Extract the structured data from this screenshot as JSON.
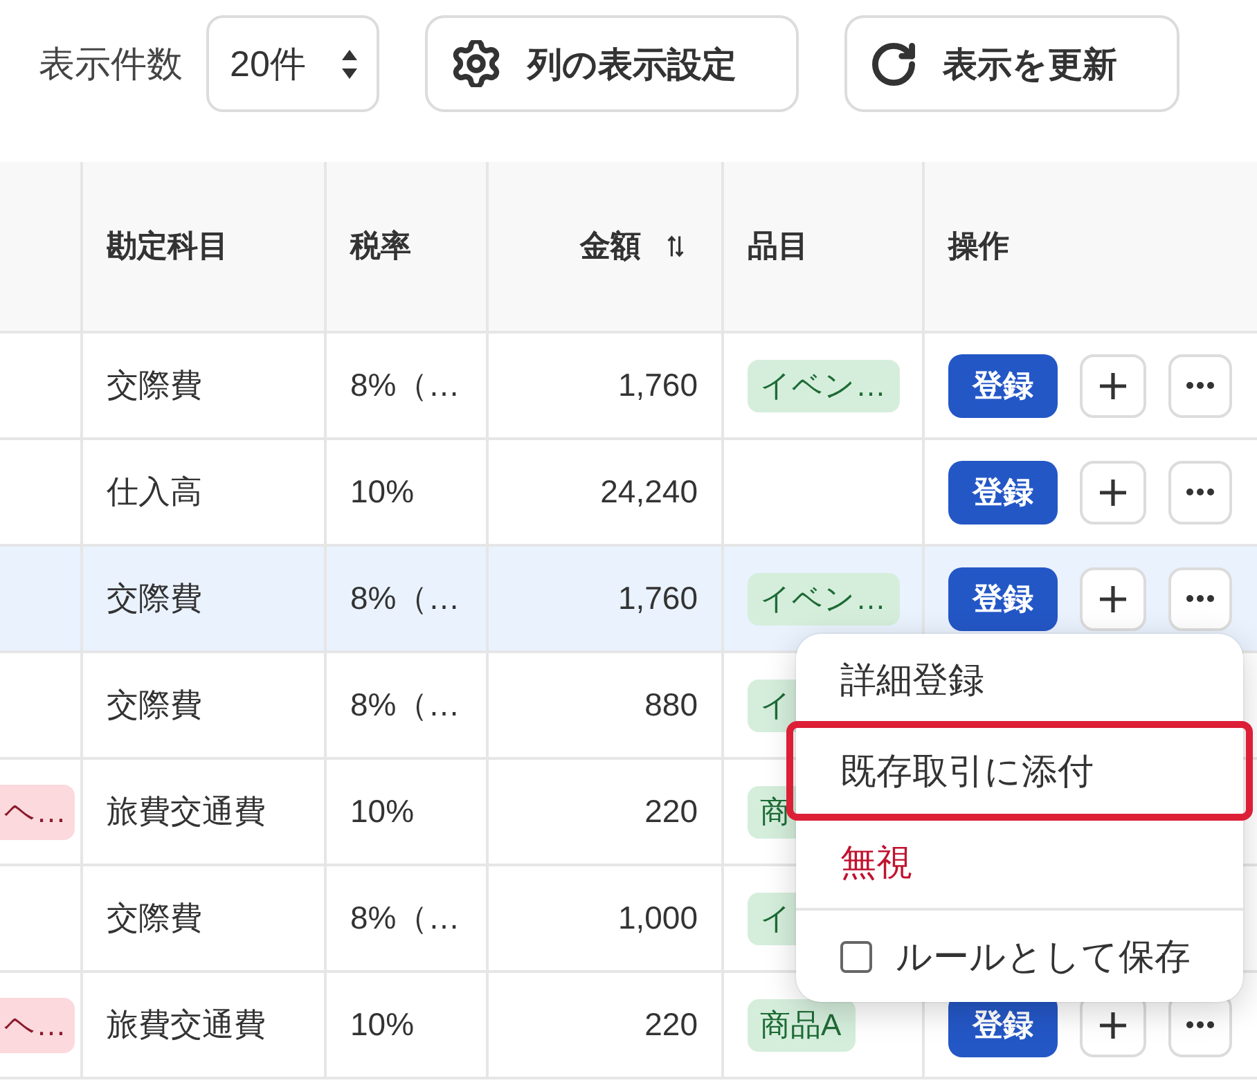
{
  "toolbar": {
    "page_size_label": "表示件数",
    "page_size": {
      "value": "20件"
    },
    "buttons": [
      {
        "kind": "columns",
        "label": "列の表示設定"
      },
      {
        "kind": "refresh",
        "label": "表示を更新"
      }
    ]
  },
  "table": {
    "columns": [
      {
        "label": "勘定科目",
        "sortable": false
      },
      {
        "label": "税率",
        "sortable": false
      },
      {
        "label": "金額",
        "sortable": true
      },
      {
        "label": "品目",
        "sortable": false
      },
      {
        "label": "操作",
        "sortable": false
      }
    ],
    "rows": [
      {
        "selected": false,
        "account": "交際費",
        "tax_rate": "8%（…",
        "amount": "1,760",
        "item_tag": "イベン…",
        "actions": {
          "register": "登録"
        }
      },
      {
        "selected": false,
        "account": "仕入高",
        "tax_rate": "10%",
        "amount": "24,240",
        "actions": {
          "register": "登録"
        }
      },
      {
        "selected": true,
        "account": "交際費",
        "tax_rate": "8%（…",
        "amount": "1,760",
        "item_tag": "イベン…",
        "actions": {
          "register": "登録"
        }
      },
      {
        "selected": false,
        "account": "交際費",
        "tax_rate": "8%（…",
        "amount": "880",
        "item_tag": "イ"
      },
      {
        "selected": false,
        "column_1_tag": "ヘ…",
        "account": "旅費交通費",
        "tax_rate": "10%",
        "amount": "220",
        "item_tag": "商"
      },
      {
        "selected": false,
        "account": "交際費",
        "tax_rate": "8%（…",
        "amount": "1,000",
        "item_tag": "イ"
      },
      {
        "selected": false,
        "column_1_tag": "ヘ…",
        "account": "旅費交通費",
        "tax_rate": "10%",
        "amount": "220",
        "item_tag": "商品A",
        "actions": {
          "register": "登録"
        }
      }
    ]
  },
  "menu": {
    "items": [
      {
        "kind": "action",
        "label": "詳細登録",
        "highlighted": false
      },
      {
        "kind": "action",
        "label": "既存取引に添付",
        "highlighted": true
      },
      {
        "kind": "danger",
        "label": "無視",
        "highlighted": false
      },
      {
        "kind": "checkbox",
        "label": "ルールとして保存",
        "checked": false,
        "highlighted": false
      }
    ]
  }
}
